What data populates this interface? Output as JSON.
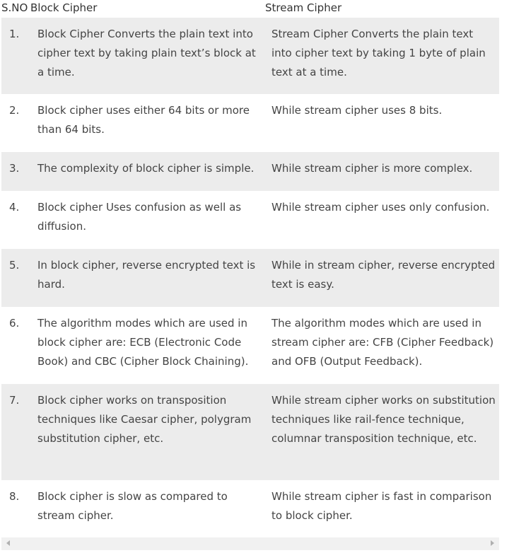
{
  "table": {
    "headers": {
      "sno": "S.NO",
      "block": "Block Cipher",
      "stream": "Stream Cipher"
    },
    "rows": [
      {
        "sno": "1.",
        "block": "Block Cipher Converts the plain text into cipher text by taking plain text’s block at a time.",
        "stream": "Stream Cipher Converts the plain text into cipher text by taking 1 byte of plain text at a time."
      },
      {
        "sno": "2.",
        "block": "Block cipher uses either 64 bits or more than 64 bits.",
        "stream": "While stream cipher uses 8 bits."
      },
      {
        "sno": "3.",
        "block": "The complexity of block cipher is simple.",
        "stream": "While stream cipher is more complex."
      },
      {
        "sno": "4.",
        "block": "Block cipher Uses confusion as well as diffusion.",
        "stream": "While stream cipher uses only confusion."
      },
      {
        "sno": "5.",
        "block": "In block cipher, reverse encrypted text is hard.",
        "stream": "While in stream cipher, reverse encrypted text is easy."
      },
      {
        "sno": "6.",
        "block": "The algorithm modes which are used in block cipher are: ECB (Electronic Code Book) and CBC (Cipher Block Chaining).",
        "stream": "The algorithm modes which are used in stream cipher are: CFB (Cipher Feedback) and OFB (Output Feedback)."
      },
      {
        "sno": "7.",
        "block": "Block cipher works on transposition techniques like Caesar cipher, polygram substitution cipher, etc.",
        "stream": "While stream cipher works on substitution techniques like rail-fence technique, columnar transposition technique, etc."
      },
      {
        "sno": "8.",
        "block": "Block cipher is slow as compared to stream cipher.",
        "stream": "While stream cipher is fast in comparison to block cipher."
      }
    ]
  },
  "colors": {
    "row_shade": "#ececec",
    "text": "#444444"
  }
}
